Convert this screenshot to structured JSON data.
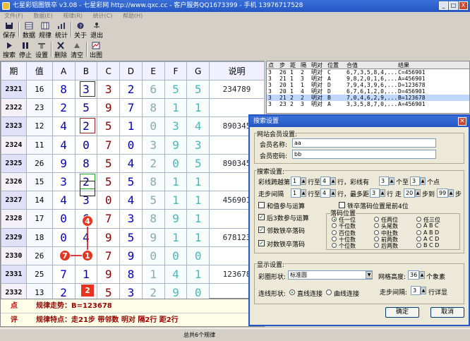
{
  "window": {
    "title": "七星彩铝图铁卒 v3.08 - 七星彩网 http://www.qxc.cc - 客户服务QQ1673399 - 手机 13976717528",
    "min": "_",
    "max": "□",
    "close": "X"
  },
  "menu": [
    "文件(F)",
    "数据(E)",
    "规律(R)",
    "统计(C)",
    "帮助(H)"
  ],
  "toolbar1": [
    {
      "label": "保存",
      "icon": "save-icon"
    },
    {
      "label": "数据",
      "icon": "data-icon"
    },
    {
      "label": "规律",
      "icon": "rule-icon"
    },
    {
      "label": "统计",
      "icon": "stats-icon"
    },
    {
      "label": "关于",
      "icon": "about-icon"
    },
    {
      "label": "退出",
      "icon": "exit-icon"
    }
  ],
  "toolbar2": [
    {
      "label": "搜索",
      "icon": "search-icon"
    },
    {
      "label": "停止",
      "icon": "stop-icon"
    },
    {
      "label": "设置",
      "icon": "settings-icon"
    },
    {
      "label": "删除",
      "icon": "delete-icon"
    },
    {
      "label": "清空",
      "icon": "clear-icon"
    },
    {
      "label": "出图",
      "icon": "chart-icon"
    }
  ],
  "grid": {
    "headers": [
      "期",
      "值",
      "A",
      "B",
      "C",
      "D",
      "E",
      "F",
      "G",
      "说明"
    ],
    "rows": [
      {
        "period": "2321",
        "value": "16",
        "d": [
          "8",
          "3",
          "3",
          "2",
          "6",
          "5",
          "5"
        ],
        "note": "234789"
      },
      {
        "period": "2322",
        "value": "23",
        "d": [
          "2",
          "5",
          "9",
          "7",
          "8",
          "1",
          "1"
        ],
        "note": ""
      },
      {
        "period": "2323",
        "value": "12",
        "d": [
          "4",
          "2",
          "5",
          "1",
          "0",
          "3",
          "4"
        ],
        "note": "890345"
      },
      {
        "period": "2324",
        "value": "11",
        "d": [
          "4",
          "0",
          "7",
          "0",
          "3",
          "9",
          "3"
        ],
        "note": ""
      },
      {
        "period": "2325",
        "value": "26",
        "d": [
          "9",
          "8",
          "5",
          "4",
          "2",
          "0",
          "5"
        ],
        "note": "890345"
      },
      {
        "period": "2326",
        "value": "15",
        "d": [
          "3",
          "2",
          "5",
          "5",
          "8",
          "1",
          "1"
        ],
        "note": ""
      },
      {
        "period": "2327",
        "value": "14",
        "d": [
          "4",
          "3",
          "0",
          "4",
          "5",
          "1",
          "1"
        ],
        "note": "456901"
      },
      {
        "period": "2328",
        "value": "17",
        "d": [
          "0",
          "6",
          "7",
          "3",
          "8",
          "9",
          "1"
        ],
        "note": ""
      },
      {
        "period": "2329",
        "value": "18",
        "d": [
          "0",
          "4",
          "9",
          "5",
          "9",
          "1",
          "1"
        ],
        "note": "678123"
      },
      {
        "period": "2330",
        "value": "26",
        "d": [
          "6",
          "4",
          "7",
          "9",
          "0",
          "0",
          "0"
        ],
        "note": ""
      },
      {
        "period": "2331",
        "value": "25",
        "d": [
          "7",
          "1",
          "9",
          "8",
          "1",
          "4",
          "1"
        ],
        "note": "123678"
      },
      {
        "period": "2332",
        "value": "13",
        "d": [
          "2",
          "3",
          "5",
          "3",
          "2",
          "9",
          "0"
        ],
        "note": ""
      }
    ],
    "predict": "2"
  },
  "summary": {
    "r1_label": "点",
    "r1_text": "规律走势：B=123678",
    "r2_label": "评",
    "r2_text": "规律特点：走21步  带邻数  明对    隔2行  距2行"
  },
  "status": "总共6个规律",
  "result_list": {
    "headers": [
      "点",
      "步",
      "距",
      "隔",
      "明对",
      "位置",
      "合值",
      "结果"
    ],
    "rows": [
      [
        "3",
        "26",
        "1",
        "2",
        "明对",
        "C",
        "6,7,3,5,8,4,...",
        "C=456901"
      ],
      [
        "3",
        "21",
        "1",
        "3",
        "明对",
        "A",
        "9,8,2,0,1,6,...",
        "A=456901"
      ],
      [
        "3",
        "20",
        "1",
        "1",
        "明对",
        "D",
        "7,9,4,3,9,6,...",
        "D=123678"
      ],
      [
        "3",
        "20",
        "1",
        "4",
        "明对",
        "D",
        "6,7,6,1,2,0,...",
        "D=456901"
      ],
      [
        "3",
        "21",
        "2",
        "2",
        "明对",
        "B",
        "7,0,4,6,2,9,...",
        "B=123678"
      ],
      [
        "3",
        "23",
        "2",
        "3",
        "明对",
        "A",
        "3,3,5,8,7,0,...",
        "A=456901"
      ]
    ]
  },
  "dialog": {
    "title": "搜索设置",
    "member_group": "网站会员设置:",
    "member_name_label": "会员名称:",
    "member_name": "aa",
    "member_pwd_label": "会员密码:",
    "member_pwd": "bb",
    "search_group": "搜索设置:",
    "l1": [
      "彩线跨越第",
      "1",
      "行至",
      "4",
      "行，彩线有",
      "3",
      "个至",
      "3",
      "个点"
    ],
    "l2": [
      "走步间隔",
      "1",
      "行至",
      "4",
      "行，最多距",
      "3",
      "行  走",
      "20",
      "步到",
      "99",
      "步"
    ],
    "cb_sum": "和值参与运算",
    "cb_fall": "铁卒落码位置是前4位",
    "cb_3": "后3数参与运算",
    "cb_adj": "邻数铁卒落码",
    "cb_pair": "对数铁卒落码",
    "fall_group": "落码位置",
    "radios": [
      "任一位",
      "任两位",
      "任三位",
      "千位数",
      "头尾数",
      "A B C",
      "百位数",
      "中肚数",
      "A B D",
      "十位数",
      "前两数",
      "A C D",
      "个位数",
      "后两数",
      "B C D"
    ],
    "display_group": "显示设置:",
    "shape_label": "彩圈形状:",
    "shape_value": "标准圆",
    "grid_h_label": "网格高度:",
    "grid_h": "36",
    "grid_h_unit": "个象素",
    "line_label": "连线形状:",
    "line_opt1": "直线连接",
    "line_opt2": "曲线连接",
    "step_label": "走步间隔:",
    "step_val": "3",
    "step_unit": "行详显",
    "ok": "确定",
    "cancel": "取消"
  },
  "markers": [
    {
      "n": "4"
    },
    {
      "n": "1"
    },
    {
      "n": "7"
    }
  ]
}
